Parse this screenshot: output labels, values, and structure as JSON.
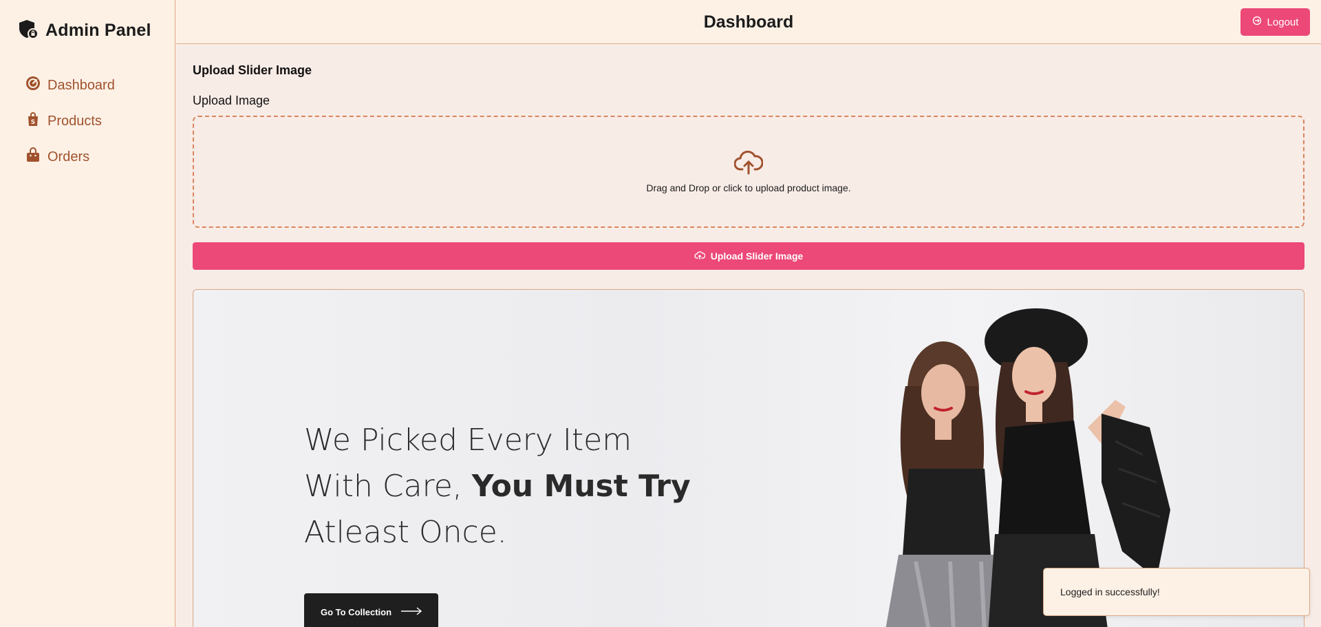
{
  "sidebar": {
    "brand": "Admin Panel",
    "items": [
      {
        "label": "Dashboard",
        "icon": "speedometer-icon"
      },
      {
        "label": "Products",
        "icon": "shopping-bag-icon"
      },
      {
        "label": "Orders",
        "icon": "shopping-basket-icon"
      }
    ]
  },
  "header": {
    "title": "Dashboard",
    "logout_label": "Logout"
  },
  "upload": {
    "section_title": "Upload Slider Image",
    "field_label": "Upload Image",
    "dropzone_text": "Drag and Drop or click to upload product image.",
    "button_label": "Upload Slider Image"
  },
  "slider": {
    "line1": "We Picked Every Item",
    "line2_regular": "With Care, ",
    "line2_bold": "You Must Try",
    "line3": "Atleast Once.",
    "button_label": "Go To Collection"
  },
  "toast": {
    "message": "Logged in successfully!"
  },
  "colors": {
    "accent": "#ec4878",
    "nav_text": "#a0522d",
    "background": "#fdf1e6",
    "border": "#d9a784"
  }
}
